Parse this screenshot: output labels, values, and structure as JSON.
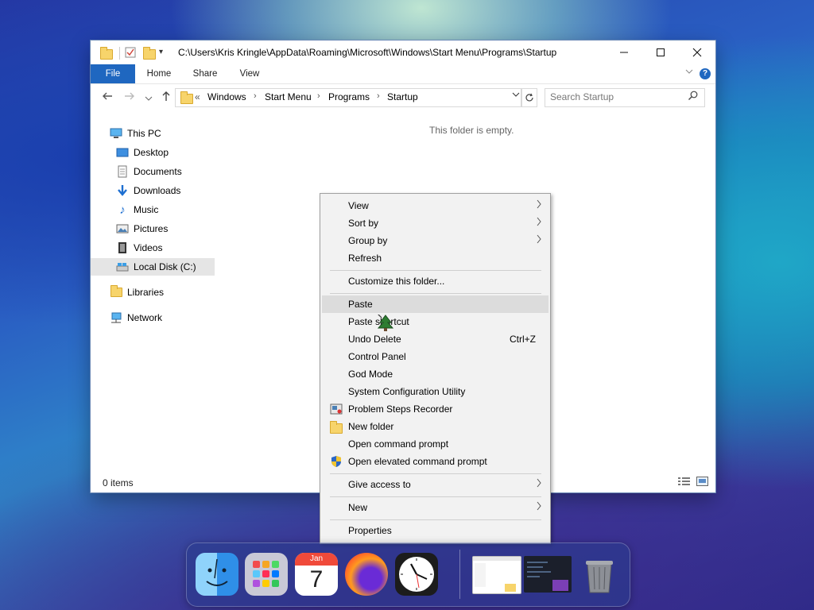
{
  "window": {
    "title_path": "C:\\Users\\Kris Kringle\\AppData\\Roaming\\Microsoft\\Windows\\Start Menu\\Programs\\Startup",
    "controls": {
      "minimize": "—",
      "maximize": "☐",
      "close": "✕"
    }
  },
  "ribbon": {
    "tabs": [
      {
        "label": "File"
      },
      {
        "label": "Home"
      },
      {
        "label": "Share"
      },
      {
        "label": "View"
      }
    ],
    "help": "?"
  },
  "address": {
    "overflow": "«",
    "segments": [
      "Windows",
      "Start Menu",
      "Programs",
      "Startup"
    ]
  },
  "search": {
    "placeholder": "Search Startup"
  },
  "nav_tree": {
    "this_pc": "This PC",
    "items": [
      {
        "label": "Desktop",
        "icon": "desktop-icon"
      },
      {
        "label": "Documents",
        "icon": "documents-icon"
      },
      {
        "label": "Downloads",
        "icon": "downloads-icon"
      },
      {
        "label": "Music",
        "icon": "music-icon"
      },
      {
        "label": "Pictures",
        "icon": "pictures-icon"
      },
      {
        "label": "Videos",
        "icon": "videos-icon"
      },
      {
        "label": "Local Disk (C:)",
        "icon": "drive-icon",
        "selected": true
      }
    ],
    "libraries": "Libraries",
    "network": "Network"
  },
  "content": {
    "empty_message": "This folder is empty."
  },
  "statusbar": {
    "item_count": "0 items"
  },
  "context_menu": {
    "items": [
      {
        "label": "View",
        "submenu": true
      },
      {
        "label": "Sort by",
        "submenu": true
      },
      {
        "label": "Group by",
        "submenu": true
      },
      {
        "label": "Refresh"
      },
      {
        "label": "Customize this folder..."
      },
      {
        "label": "Paste",
        "highlighted": true
      },
      {
        "label": "Paste shortcut"
      },
      {
        "label": "Undo Delete",
        "shortcut": "Ctrl+Z"
      },
      {
        "label": "Control Panel"
      },
      {
        "label": "God Mode"
      },
      {
        "label": "System Configuration Utility"
      },
      {
        "label": "Problem Steps Recorder",
        "icon": "steps-recorder-icon"
      },
      {
        "label": "New folder",
        "icon": "folder-icon"
      },
      {
        "label": "Open command prompt"
      },
      {
        "label": "Open elevated command prompt",
        "icon": "uac-shield-icon"
      },
      {
        "label": "Give access to",
        "submenu": true
      },
      {
        "label": "New",
        "submenu": true
      },
      {
        "label": "Properties"
      }
    ]
  },
  "dock": {
    "calendar": {
      "month": "Jan",
      "day": "7"
    },
    "apps": [
      "finder-icon",
      "launchpad-icon",
      "calendar-icon",
      "firefox-icon",
      "clock-icon",
      "explorer-window-thumbnail",
      "terminal-window-thumbnail",
      "trash-icon"
    ]
  },
  "colors": {
    "accent": "#1f67c0",
    "menu_bg": "#f2f2f2",
    "menu_highlight": "#dcdcdc"
  }
}
